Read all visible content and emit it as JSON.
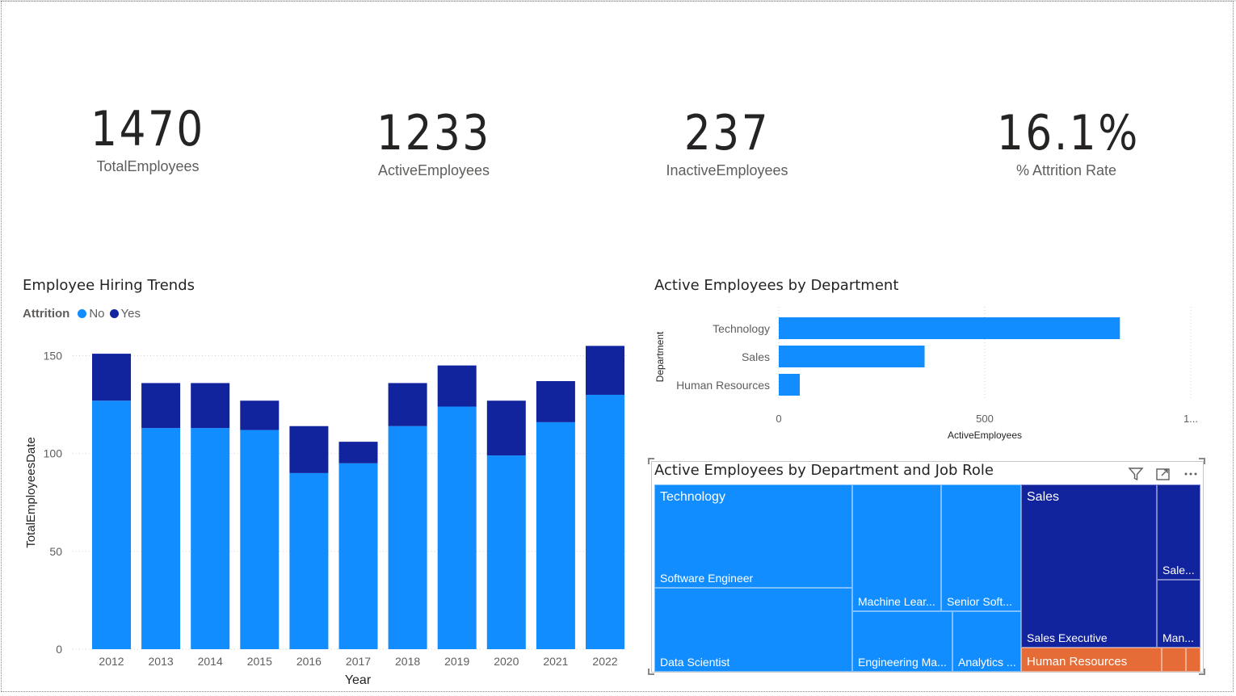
{
  "kpis": [
    {
      "value": "1470",
      "label": "TotalEmployees"
    },
    {
      "value": "1233",
      "label": "ActiveEmployees"
    },
    {
      "value": "237",
      "label": "InactiveEmployees"
    },
    {
      "value": "16.1%",
      "label": "% Attrition Rate"
    }
  ],
  "colors": {
    "no": "#118DFF",
    "yes": "#12239E",
    "hr": "#E66C37",
    "grid": "#d2d0ce",
    "axis_text": "#605e5c"
  },
  "hiring_chart": {
    "title": "Employee Hiring Trends",
    "legend_title": "Attrition",
    "legend_no": "No",
    "legend_yes": "Yes",
    "xlabel": "Year",
    "ylabel": "TotalEmployeesDate"
  },
  "department_chart": {
    "title": "Active Employees by Department",
    "xlabel": "ActiveEmployees",
    "ylabel": "Department"
  },
  "treemap": {
    "title": "Active Employees by Department and Job Role",
    "icons": [
      "filter-icon",
      "focus-mode-icon",
      "more-options-icon"
    ],
    "technology_label": "Technology",
    "sales_label": "Sales",
    "tiles": {
      "software_engineer": "Software Engineer",
      "data_scientist": "Data Scientist",
      "machine_learning": "Machine Lear...",
      "senior_software": "Senior Soft...",
      "engineering_manager": "Engineering Ma...",
      "analytics": "Analytics ...",
      "sales_executive": "Sales Executive",
      "sales_other": "Sale...",
      "manager": "Man...",
      "human_resources": "Human Resources"
    }
  },
  "chart_data": [
    {
      "type": "bar",
      "stacked": true,
      "title": "Employee Hiring Trends",
      "xlabel": "Year",
      "ylabel": "TotalEmployeesDate",
      "categories": [
        "2012",
        "2013",
        "2014",
        "2015",
        "2016",
        "2017",
        "2018",
        "2019",
        "2020",
        "2021",
        "2022"
      ],
      "series": [
        {
          "name": "No",
          "values": [
            127,
            113,
            113,
            112,
            90,
            95,
            114,
            124,
            99,
            116,
            130
          ]
        },
        {
          "name": "Yes",
          "values": [
            24,
            23,
            23,
            15,
            24,
            11,
            22,
            21,
            28,
            21,
            25
          ]
        }
      ],
      "yticks": [
        0,
        50,
        100,
        150
      ],
      "ylim": [
        0,
        160
      ],
      "grid": true,
      "legend": "top-left"
    },
    {
      "type": "bar",
      "orientation": "horizontal",
      "title": "Active Employees by Department",
      "xlabel": "ActiveEmployees",
      "ylabel": "Department",
      "categories": [
        "Technology",
        "Sales",
        "Human Resources"
      ],
      "values": [
        828,
        354,
        51
      ],
      "xticks": [
        "0",
        "500",
        "1..."
      ],
      "xlim": [
        0,
        1000
      ],
      "grid": true
    }
  ]
}
